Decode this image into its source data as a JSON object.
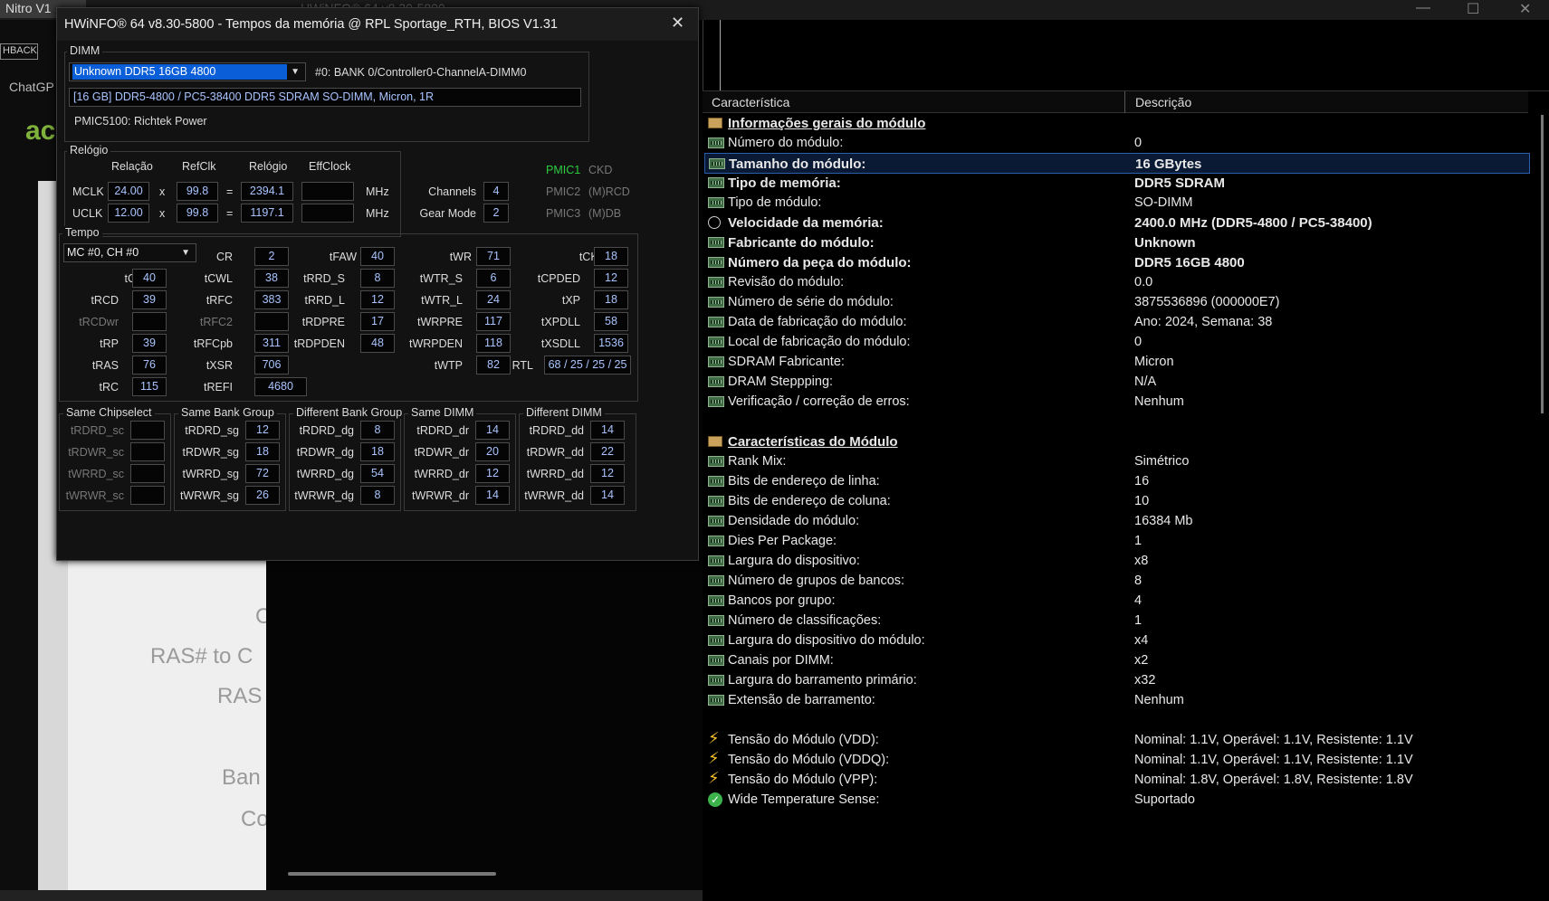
{
  "background": {
    "top_left_tab": "Nitro V1",
    "top_middle_tab": "HWiNFO® 64 v8.30-5800",
    "feedback_btn": "HBACK",
    "chatgpt_label": "ChatGP",
    "acer_logo": "ac",
    "doc_texts": [
      "C",
      "RAS# to C",
      "RAS",
      "Ban",
      "Co"
    ]
  },
  "dialog": {
    "title": "HWiNFO® 64 v8.30-5800 - Tempos da memória @ RPL Sportage_RTH, BIOS V1.31",
    "close": "✕",
    "dimm": {
      "group_label": "DIMM",
      "selected": "Unknown DDR5 16GB 4800",
      "slot": "#0: BANK 0/Controller0-ChannelA-DIMM0",
      "spec": "[16 GB] DDR5-4800 / PC5-38400 DDR5 SDRAM SO-DIMM, Micron, 1R",
      "pmic": "PMIC5100: Richtek Power"
    },
    "clock": {
      "group_label": "Relógio",
      "col_relacao": "Relação",
      "col_refclk": "RefClk",
      "col_relogio": "Relógio",
      "col_effclock": "EffClock",
      "mclk_label": "MCLK",
      "uclk_label": "UCLK",
      "mclk_ratio": "24.00",
      "mclk_ref": "99.8",
      "mclk_clock": "2394.1",
      "mclk_eff": "",
      "uclk_ratio": "12.00",
      "uclk_ref": "99.8",
      "uclk_clock": "1197.1",
      "uclk_eff": "",
      "x": "x",
      "eq": "=",
      "unit": "MHz",
      "channels_label": "Channels",
      "channels": "4",
      "gear_label": "Gear Mode",
      "gear": "2",
      "pmic1": "PMIC1",
      "pmic2": "PMIC2",
      "pmic3": "PMIC3",
      "ckd": "CKD",
      "mrcd": "(M)RCD",
      "mdb": "(M)DB"
    },
    "timing": {
      "group_label": "Tempo",
      "channel_select": "MC #0, CH #0",
      "items": [
        {
          "label": "CR",
          "value": "2"
        },
        {
          "label": "tFAW",
          "value": "40"
        },
        {
          "label": "tWR",
          "value": "71"
        },
        {
          "label": "tCKE",
          "value": "18"
        },
        {
          "label": "tCL",
          "value": "40"
        },
        {
          "label": "tCWL",
          "value": "38"
        },
        {
          "label": "tRRD_S",
          "value": "8"
        },
        {
          "label": "tWTR_S",
          "value": "6"
        },
        {
          "label": "tCPDED",
          "value": "12"
        },
        {
          "label": "tRCD",
          "value": "39"
        },
        {
          "label": "tRFC",
          "value": "383"
        },
        {
          "label": "tRRD_L",
          "value": "12"
        },
        {
          "label": "tWTR_L",
          "value": "24"
        },
        {
          "label": "tXP",
          "value": "18"
        },
        {
          "label": "tRCDwr",
          "value": ""
        },
        {
          "label": "tRFC2",
          "value": ""
        },
        {
          "label": "tRDPRE",
          "value": "17"
        },
        {
          "label": "tWRPRE",
          "value": "117"
        },
        {
          "label": "tXPDLL",
          "value": "58"
        },
        {
          "label": "tRP",
          "value": "39"
        },
        {
          "label": "tRFCpb",
          "value": "311"
        },
        {
          "label": "tRDPDEN",
          "value": "48"
        },
        {
          "label": "tWRPDEN",
          "value": "118"
        },
        {
          "label": "tXSDLL",
          "value": "1536"
        },
        {
          "label": "tRAS",
          "value": "76"
        },
        {
          "label": "tXSR",
          "value": "706"
        },
        {
          "label": "tWTP",
          "value": "82"
        },
        {
          "label": "RTL",
          "value": "68 / 25 / 25 / 25"
        },
        {
          "label": "tRC",
          "value": "115"
        },
        {
          "label": "tREFI",
          "value": "4680"
        }
      ]
    },
    "turnaround": {
      "groups": [
        "Same Chipselect",
        "Same Bank Group",
        "Different Bank Group",
        "Same DIMM",
        "Different DIMM"
      ],
      "cols": [
        [
          {
            "label": "tRDRD_sc",
            "value": ""
          },
          {
            "label": "tRDWR_sc",
            "value": ""
          },
          {
            "label": "tWRRD_sc",
            "value": ""
          },
          {
            "label": "tWRWR_sc",
            "value": ""
          }
        ],
        [
          {
            "label": "tRDRD_sg",
            "value": "12"
          },
          {
            "label": "tRDWR_sg",
            "value": "18"
          },
          {
            "label": "tWRRD_sg",
            "value": "72"
          },
          {
            "label": "tWRWR_sg",
            "value": "26"
          }
        ],
        [
          {
            "label": "tRDRD_dg",
            "value": "8"
          },
          {
            "label": "tRDWR_dg",
            "value": "18"
          },
          {
            "label": "tWRRD_dg",
            "value": "54"
          },
          {
            "label": "tWRWR_dg",
            "value": "8"
          }
        ],
        [
          {
            "label": "tRDRD_dr",
            "value": "14"
          },
          {
            "label": "tRDWR_dr",
            "value": "20"
          },
          {
            "label": "tWRRD_dr",
            "value": "12"
          },
          {
            "label": "tWRWR_dr",
            "value": "14"
          }
        ],
        [
          {
            "label": "tRDRD_dd",
            "value": "14"
          },
          {
            "label": "tRDWR_dd",
            "value": "22"
          },
          {
            "label": "tWRRD_dd",
            "value": "12"
          },
          {
            "label": "tWRWR_dd",
            "value": "14"
          }
        ]
      ]
    }
  },
  "info_panel": {
    "col_feature": "Característica",
    "col_description": "Descrição",
    "rows": [
      {
        "icon": "book",
        "style": "head",
        "k": "Informações gerais do módulo",
        "v": ""
      },
      {
        "icon": "chip",
        "style": "",
        "k": "Número do módulo:",
        "v": "0"
      },
      {
        "icon": "chip",
        "style": "bold sel",
        "k": "Tamanho do módulo:",
        "v": "16 GBytes"
      },
      {
        "icon": "chip",
        "style": "bold",
        "k": "Tipo de memória:",
        "v": "DDR5 SDRAM"
      },
      {
        "icon": "chip",
        "style": "",
        "k": "Tipo de módulo:",
        "v": "SO-DIMM"
      },
      {
        "icon": "clock",
        "style": "bold",
        "k": "Velocidade da memória:",
        "v": "2400.0 MHz (DDR5-4800 / PC5-38400)"
      },
      {
        "icon": "chip",
        "style": "bold",
        "k": "Fabricante do módulo:",
        "v": "Unknown"
      },
      {
        "icon": "chip",
        "style": "bold",
        "k": "Número da peça do módulo:",
        "v": "DDR5 16GB 4800"
      },
      {
        "icon": "chip",
        "style": "",
        "k": "Revisão do módulo:",
        "v": "0.0"
      },
      {
        "icon": "chip",
        "style": "",
        "k": "Número de série do módulo:",
        "v": "3875536896 (000000E7)"
      },
      {
        "icon": "chip",
        "style": "",
        "k": "Data de fabricação do módulo:",
        "v": "Ano: 2024, Semana: 38"
      },
      {
        "icon": "chip",
        "style": "",
        "k": "Local de fabricação do módulo:",
        "v": "0"
      },
      {
        "icon": "chip",
        "style": "",
        "k": "SDRAM Fabricante:",
        "v": "Micron"
      },
      {
        "icon": "chip",
        "style": "",
        "k": "DRAM Steppping:",
        "v": "N/A"
      },
      {
        "icon": "chip",
        "style": "",
        "k": "Verificação / correção de erros:",
        "v": "Nenhum"
      },
      {
        "icon": "",
        "style": "",
        "k": "",
        "v": ""
      },
      {
        "icon": "book",
        "style": "head",
        "k": "Características do Módulo",
        "v": ""
      },
      {
        "icon": "chip",
        "style": "",
        "k": "Rank Mix:",
        "v": "Simétrico"
      },
      {
        "icon": "chip",
        "style": "",
        "k": "Bits de endereço de linha:",
        "v": "16"
      },
      {
        "icon": "chip",
        "style": "",
        "k": "Bits de endereço de coluna:",
        "v": "10"
      },
      {
        "icon": "chip",
        "style": "",
        "k": "Densidade do módulo:",
        "v": "16384 Mb"
      },
      {
        "icon": "chip",
        "style": "",
        "k": "Dies Per Package:",
        "v": "1"
      },
      {
        "icon": "chip",
        "style": "",
        "k": "Largura do dispositivo:",
        "v": "x8"
      },
      {
        "icon": "chip",
        "style": "",
        "k": "Número de grupos de bancos:",
        "v": "8"
      },
      {
        "icon": "chip",
        "style": "",
        "k": "Bancos por grupo:",
        "v": "4"
      },
      {
        "icon": "chip",
        "style": "",
        "k": "Número de classificações:",
        "v": "1"
      },
      {
        "icon": "chip",
        "style": "",
        "k": "Largura do dispositivo do módulo:",
        "v": "x4"
      },
      {
        "icon": "chip",
        "style": "",
        "k": "Canais por DIMM:",
        "v": "x2"
      },
      {
        "icon": "chip",
        "style": "",
        "k": "Largura do barramento primário:",
        "v": "x32"
      },
      {
        "icon": "chip",
        "style": "",
        "k": "Extensão de barramento:",
        "v": "Nenhum"
      },
      {
        "icon": "",
        "style": "",
        "k": "",
        "v": ""
      },
      {
        "icon": "bolt",
        "style": "",
        "k": "Tensão do Módulo (VDD):",
        "v": "Nominal: 1.1V, Operável: 1.1V, Resistente: 1.1V"
      },
      {
        "icon": "bolt",
        "style": "",
        "k": "Tensão do Módulo (VDDQ):",
        "v": "Nominal: 1.1V, Operável: 1.1V, Resistente: 1.1V"
      },
      {
        "icon": "bolt",
        "style": "",
        "k": "Tensão do Módulo (VPP):",
        "v": "Nominal: 1.8V, Operável: 1.8V, Resistente: 1.8V"
      },
      {
        "icon": "check",
        "style": "",
        "k": "Wide Temperature Sense:",
        "v": "Suportado"
      }
    ]
  }
}
